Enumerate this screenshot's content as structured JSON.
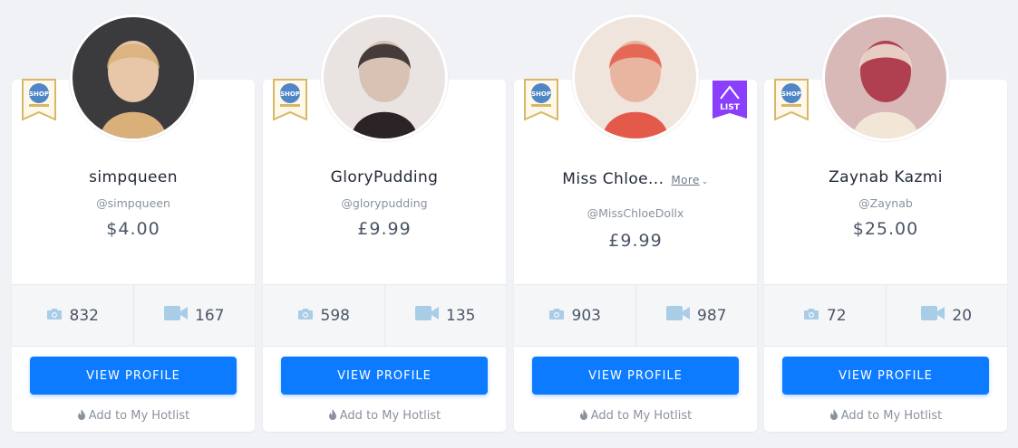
{
  "creators": [
    {
      "name": "simpqueen",
      "handle": "@simpqueen",
      "price": "$4.00",
      "photos": "832",
      "videos": "167",
      "has_more": false,
      "list_badge": false
    },
    {
      "name": "GloryPudding",
      "handle": "@glorypudding",
      "price": "£9.99",
      "photos": "598",
      "videos": "135",
      "has_more": false,
      "list_badge": false
    },
    {
      "name": "Miss Chloe...",
      "handle": "@MissChloeDollx",
      "price": "£9.99",
      "photos": "903",
      "videos": "987",
      "has_more": true,
      "list_badge": true
    },
    {
      "name": "Zaynab Kazmi",
      "handle": "@Zaynab",
      "price": "$25.00",
      "photos": "72",
      "videos": "20",
      "has_more": false,
      "list_badge": false
    }
  ],
  "labels": {
    "view_profile": "VIEW PROFILE",
    "add_hotlist": "Add to My Hotlist",
    "more": "More",
    "shop_badge_text": "SHOP",
    "list_badge_text": "LIST"
  },
  "icons": {
    "photos": "camera-icon",
    "videos": "video-camera-icon",
    "hotlist": "flame-icon",
    "more_chevron": "chevron-down-icon"
  },
  "colors": {
    "accent": "#0d7bff",
    "stat_icon": "#a9cde6",
    "list_badge": "#8a3ffc",
    "shop_badge": "#c9a64a"
  }
}
